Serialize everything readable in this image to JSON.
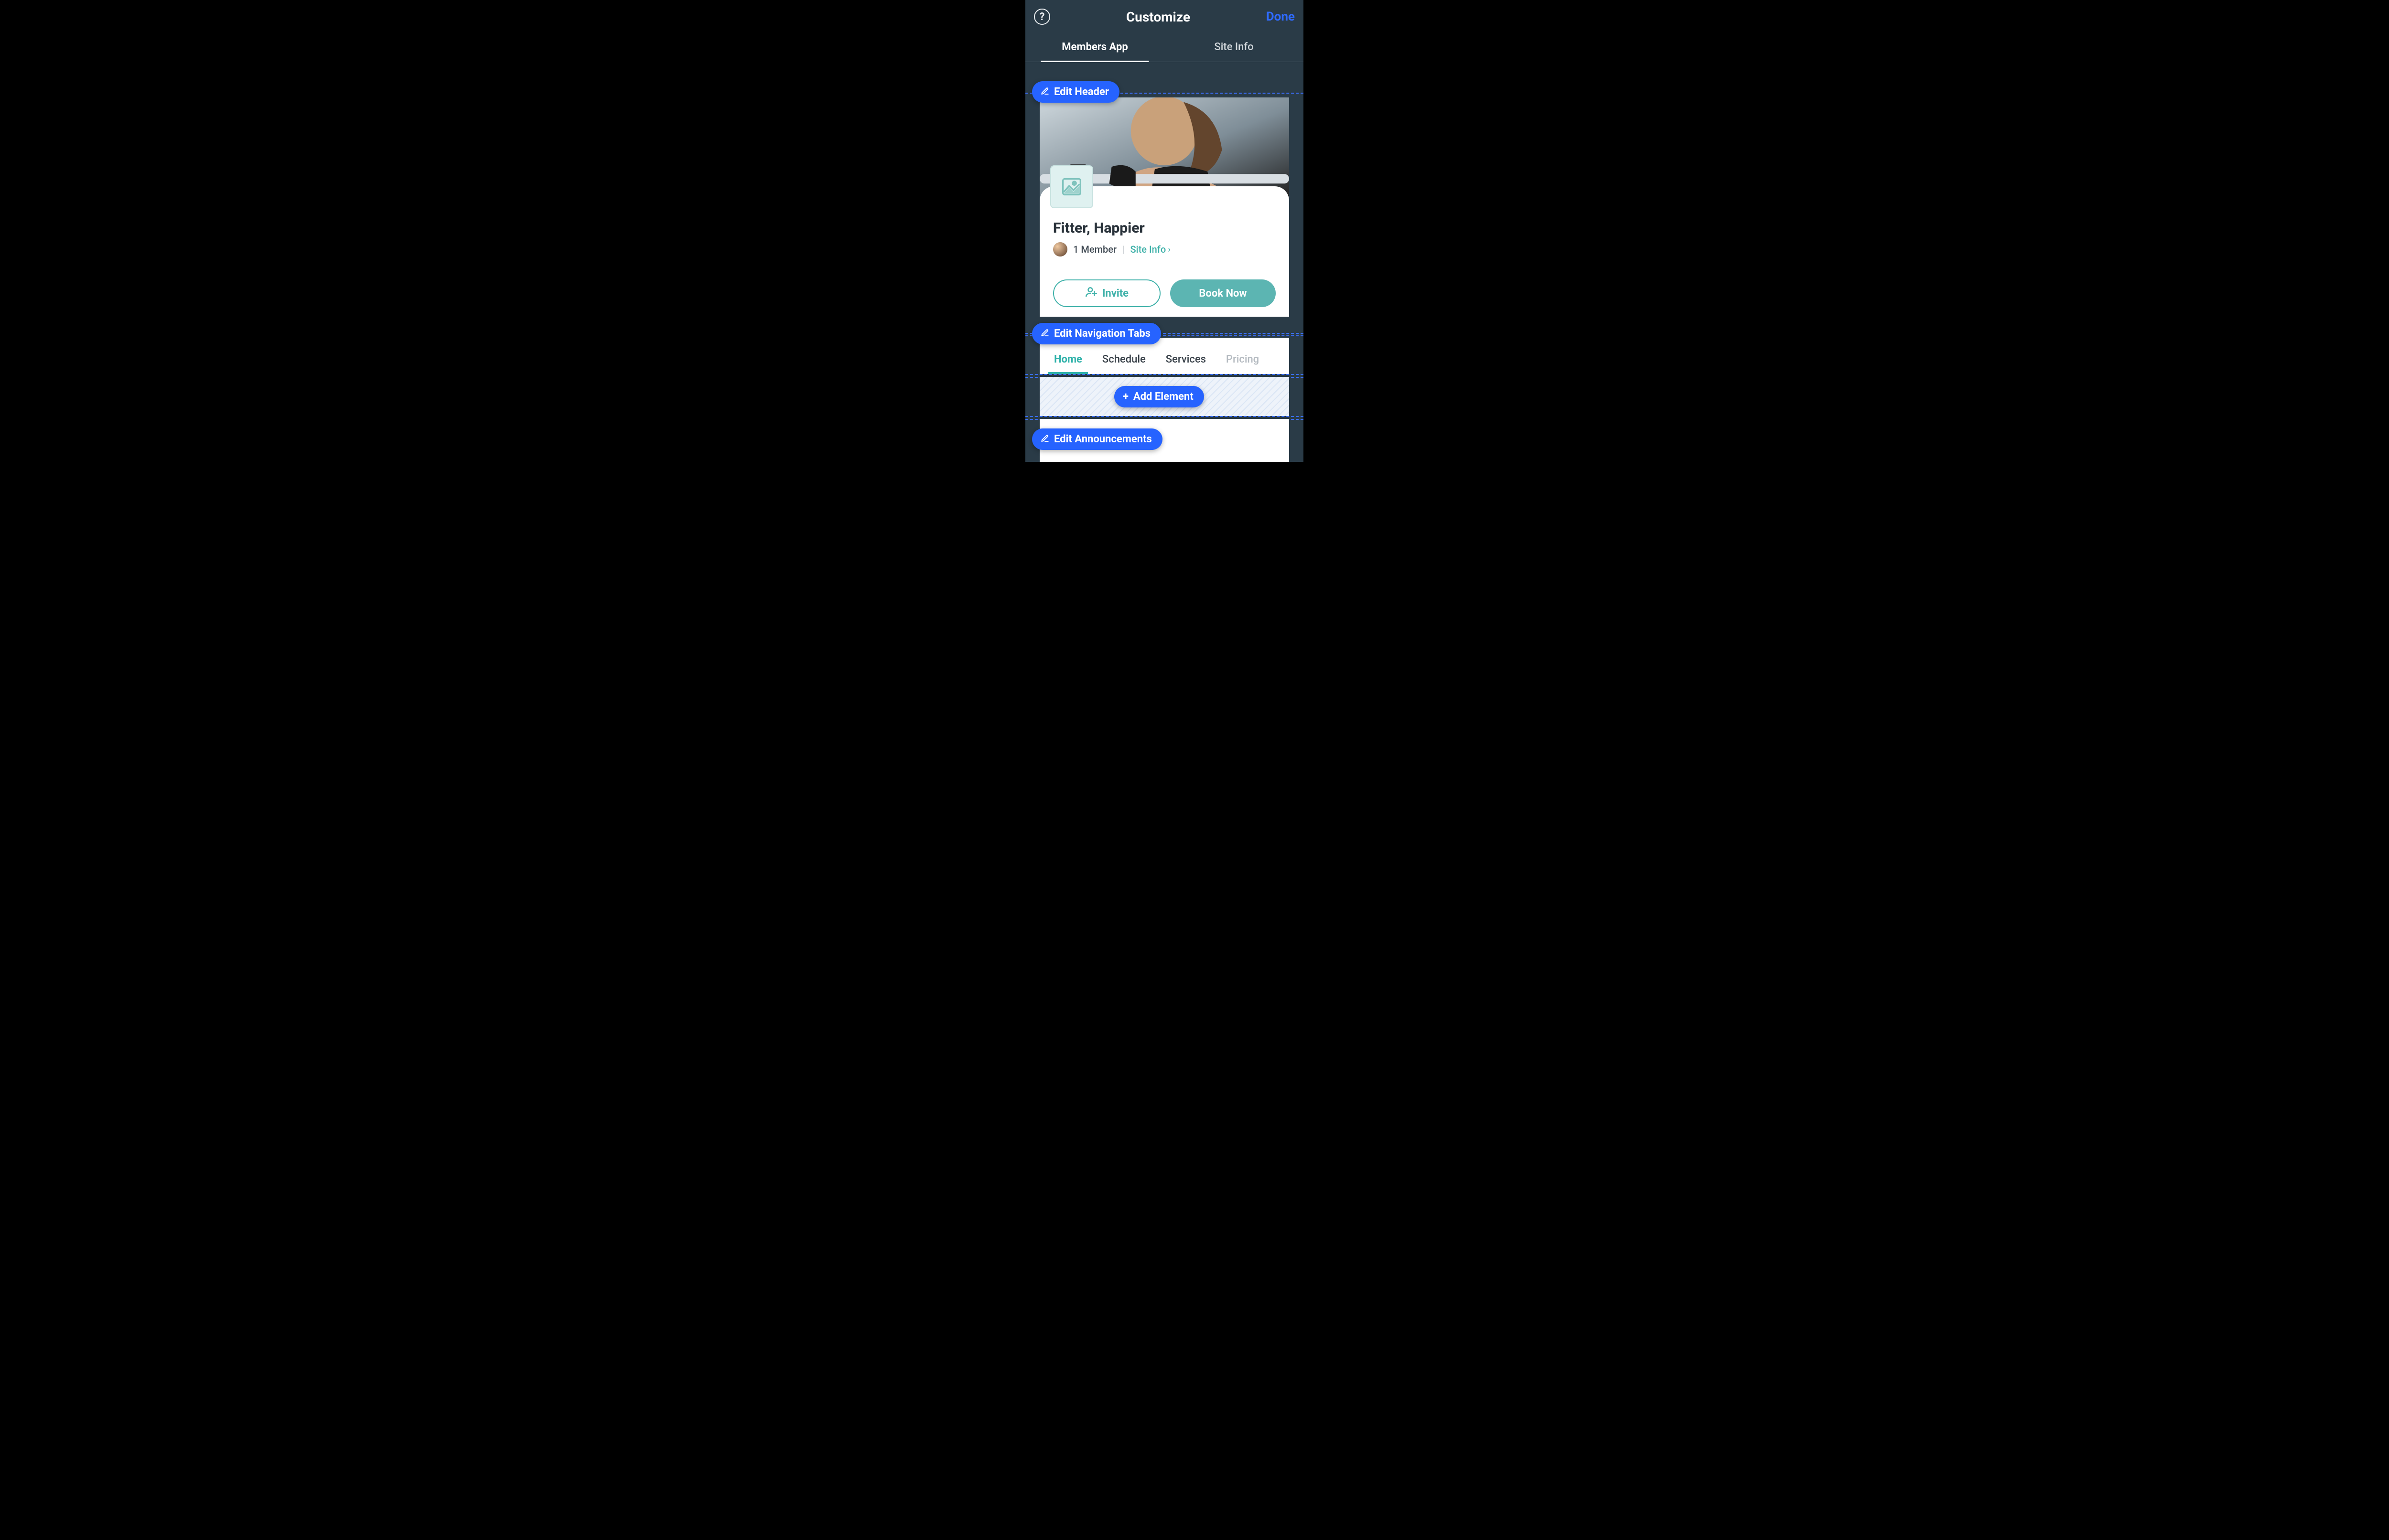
{
  "topbar": {
    "title": "Customize",
    "done": "Done",
    "help_tooltip": "?"
  },
  "maintabs": [
    {
      "label": "Members App",
      "active": true
    },
    {
      "label": "Site Info",
      "active": false
    }
  ],
  "pills": {
    "edit_header": "Edit Header",
    "edit_nav": "Edit Navigation Tabs",
    "add_element": "Add Element",
    "edit_announcements": "Edit Announcements"
  },
  "site": {
    "name": "Fitter, Happier",
    "member_count_label": "1 Member",
    "site_info_link": "Site Info"
  },
  "actions": {
    "invite": "Invite",
    "book": "Book Now"
  },
  "nav_tabs": [
    {
      "label": "Home",
      "active": true
    },
    {
      "label": "Schedule",
      "active": false
    },
    {
      "label": "Services",
      "active": false
    },
    {
      "label": "Pricing",
      "active": false,
      "truncated": true
    }
  ],
  "colors": {
    "accent_blue": "#2663ff",
    "teal": "#3fb1a9",
    "panel_bg": "#2a3b47"
  }
}
